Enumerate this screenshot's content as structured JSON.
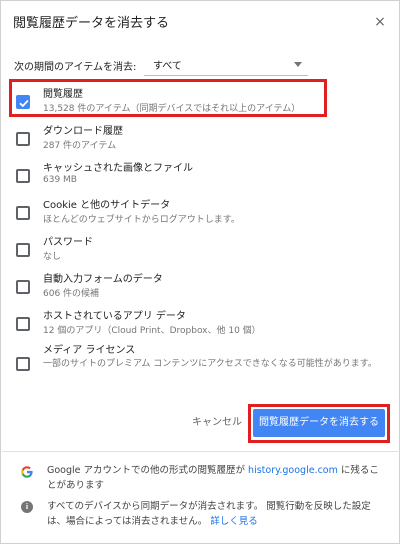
{
  "dialog": {
    "title": "閲覧履歴データを消去する",
    "close_glyph": "×"
  },
  "period": {
    "label": "次の期間のアイテムを消去:",
    "selected": "すべて"
  },
  "items": [
    {
      "title": "閲覧履歴",
      "subtitle": "13,528 件のアイテム（同期デバイスではそれ以上のアイテム）",
      "checked": true
    },
    {
      "title": "ダウンロード履歴",
      "subtitle": "287 件のアイテム",
      "checked": false
    },
    {
      "title": "キャッシュされた画像とファイル",
      "subtitle": "639 MB",
      "checked": false
    },
    {
      "title": "Cookie と他のサイトデータ",
      "subtitle": "ほとんどのウェブサイトからログアウトします。",
      "checked": false
    },
    {
      "title": "パスワード",
      "subtitle": "なし",
      "checked": false
    },
    {
      "title": "自動入力フォームのデータ",
      "subtitle": "606 件の候補",
      "checked": false
    },
    {
      "title": "ホストされているアプリ データ",
      "subtitle": "12 個のアプリ（Cloud Print、Dropbox、他 10 個）",
      "checked": false
    },
    {
      "title": "メディア ライセンス",
      "subtitle": "一部のサイトのプレミアム コンテンツにアクセスできなくなる可能性があります。",
      "checked": false
    }
  ],
  "buttons": {
    "cancel": "キャンセル",
    "clear": "閲覧履歴データを消去する"
  },
  "footer": {
    "google_text_before": "Google アカウントでの他の形式の閲覧履歴が ",
    "google_link": "history.google.com",
    "google_text_after": " に残ることがあります",
    "sync_text": "すべてのデバイスから同期データが消去されます。 閲覧行動を反映した設定は、場合によっては消去されません。",
    "sync_link": "詳しく見る"
  },
  "colors": {
    "accent": "#4285f4",
    "highlight": "#e02020",
    "link": "#1a73e8"
  }
}
